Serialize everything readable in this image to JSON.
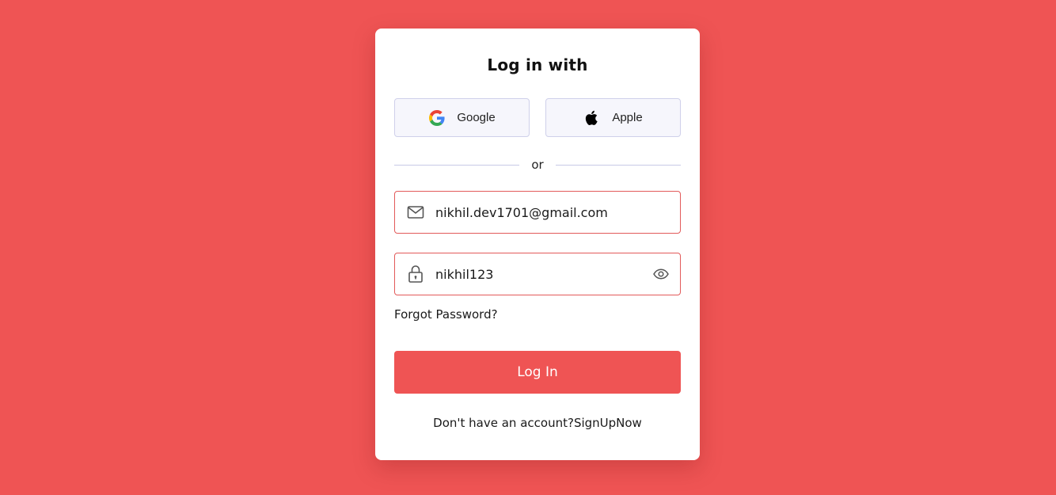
{
  "colors": {
    "background": "#EF5454",
    "card": "#FFFFFF",
    "primary_button": "#EF5454",
    "social_button_bg": "#F6F6FC",
    "social_button_border": "#CFD0EA",
    "field_border": "#E25A5A"
  },
  "login": {
    "title": "Log in with",
    "social": [
      {
        "label": "Google",
        "icon": "google-icon"
      },
      {
        "label": "Apple",
        "icon": "apple-icon"
      }
    ],
    "divider_text": "or",
    "email": {
      "value": "nikhil.dev1701@gmail.com",
      "icon": "mail-icon"
    },
    "password": {
      "value": "nikhil123",
      "icon": "lock-icon",
      "toggle_icon": "eye-icon"
    },
    "forgot_label": "Forgot Password?",
    "submit_label": "Log In",
    "signup_prompt": "Don't have an account?",
    "signup_link": "SignUpNow"
  }
}
